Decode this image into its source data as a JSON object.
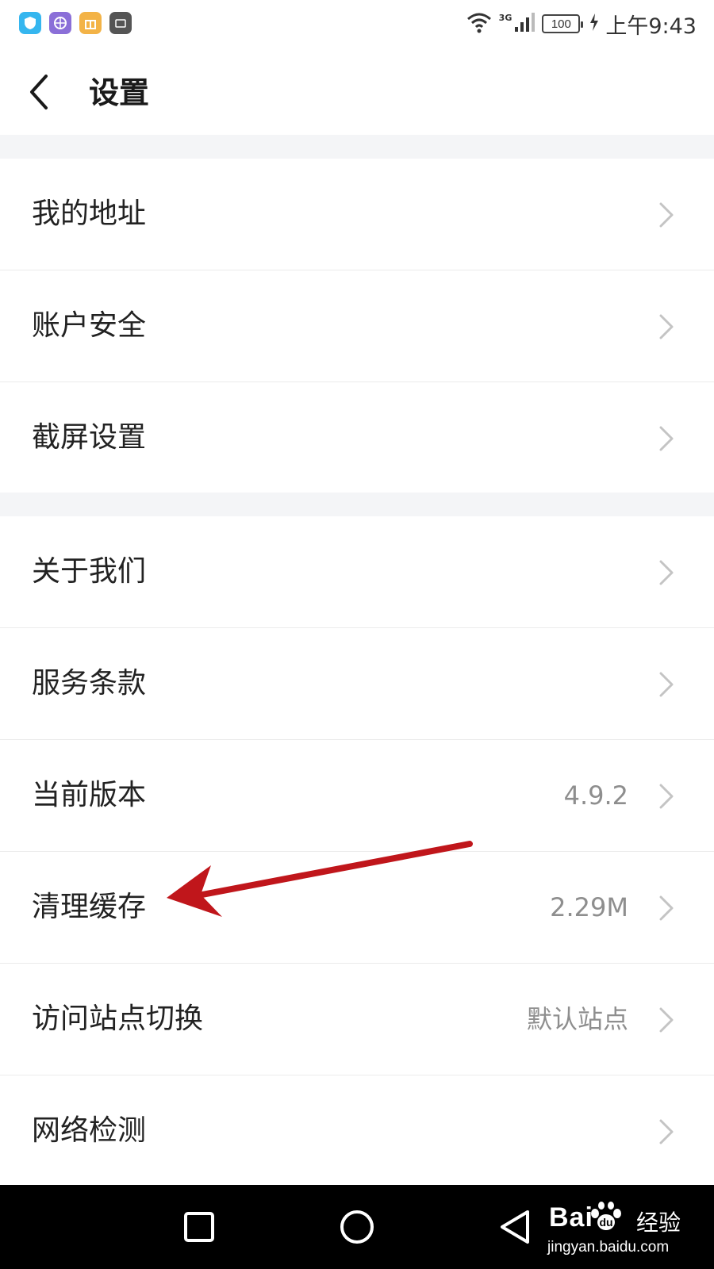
{
  "status_bar": {
    "net_type": "3G",
    "battery": "100",
    "time": "上午9:43",
    "app_icons": [
      "shield-app-icon",
      "browser-app-icon",
      "gift-app-icon",
      "huawei-app-icon"
    ]
  },
  "header": {
    "title": "设置",
    "back_icon": "chevron-left-icon"
  },
  "groups": [
    {
      "items": [
        {
          "label": "我的地址",
          "value": ""
        },
        {
          "label": "账户安全",
          "value": ""
        },
        {
          "label": "截屏设置",
          "value": ""
        }
      ]
    },
    {
      "items": [
        {
          "label": "关于我们",
          "value": ""
        },
        {
          "label": "服务条款",
          "value": ""
        },
        {
          "label": "当前版本",
          "value": "4.9.2"
        },
        {
          "label": "清理缓存",
          "value": "2.29M"
        },
        {
          "label": "访问站点切换",
          "value": "默认站点"
        },
        {
          "label": "网络检测",
          "value": ""
        }
      ]
    }
  ],
  "annotation": {
    "color": "#c0161b",
    "target": "清理缓存"
  },
  "nav_bar": {
    "buttons": [
      "recent-apps-icon",
      "home-icon",
      "back-triangle-icon"
    ]
  },
  "watermark": {
    "logo": "Bai",
    "logo_tail": "经验",
    "url": "jingyan.baidu.com"
  },
  "colors": {
    "background": "#ffffff",
    "divider": "#ebebeb",
    "section_gap": "#f4f5f7",
    "label": "#222222",
    "value": "#8e8e8e",
    "nav_bar": "#000000"
  }
}
